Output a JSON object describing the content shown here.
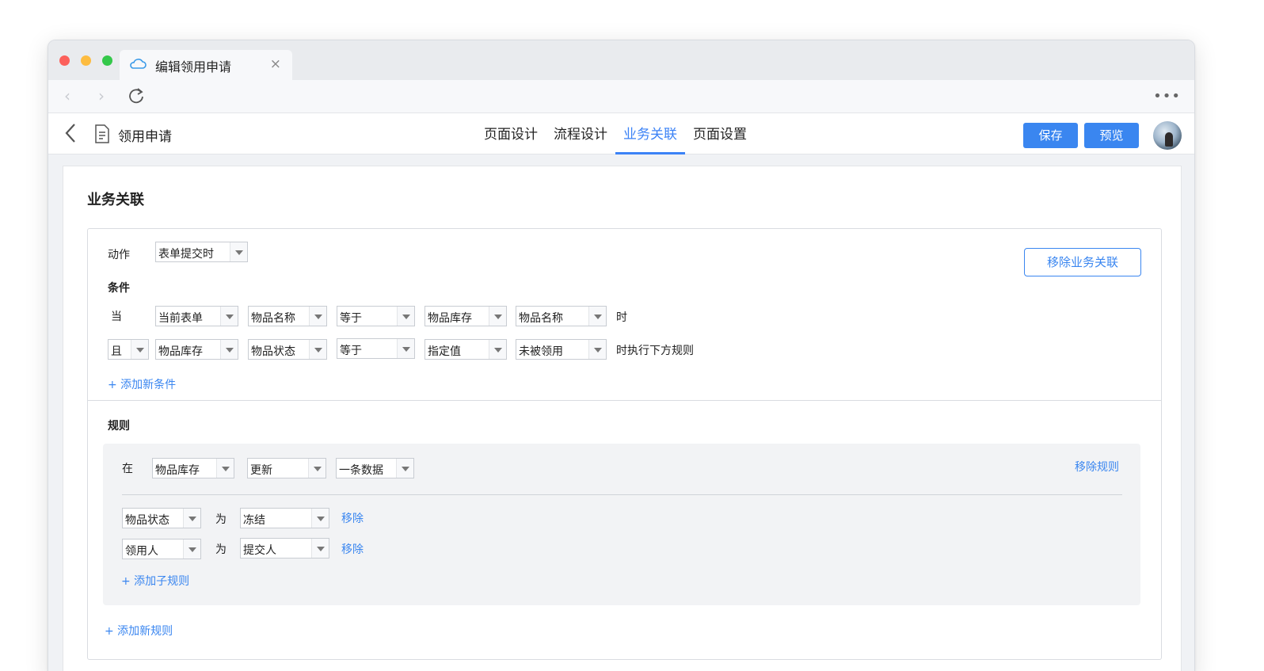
{
  "browser": {
    "tab_title": "编辑领用申请",
    "tab_close": "×",
    "back": "‹",
    "forward": "›",
    "more": "•••"
  },
  "app": {
    "title": "领用申请",
    "tabs": [
      "页面设计",
      "流程设计",
      "业务关联",
      "页面设置"
    ],
    "active_tab": "业务关联",
    "save_label": "保存",
    "preview_label": "预览",
    "accent_color": "#3a86f0"
  },
  "page": {
    "section_title": "业务关联",
    "remove_association": "移除业务关联",
    "action": {
      "label": "动作",
      "value": "表单提交时"
    },
    "conditions": {
      "label": "条件",
      "row1": {
        "prefix": "当",
        "fields": [
          "当前表单",
          "物品名称",
          "等于",
          "物品库存",
          "物品名称"
        ],
        "suffix": "时"
      },
      "row2": {
        "connector": "且",
        "fields": [
          "物品库存",
          "物品状态",
          "等于",
          "指定值",
          "未被领用"
        ],
        "suffix": "时执行下方规则"
      },
      "add_label": "+ 添加新条件"
    },
    "rules": {
      "label": "规则",
      "in_label": "在",
      "target": [
        "物品库存",
        "更新",
        "一条数据"
      ],
      "remove_rule": "移除规则",
      "sub_rules": [
        {
          "field": "物品状态",
          "as": "为",
          "value": "冻结",
          "remove": "移除"
        },
        {
          "field": "领用人",
          "as": "为",
          "value": "提交人",
          "remove": "移除"
        }
      ],
      "add_sub_rule": "+ 添加子规则",
      "add_rule": "+ 添加新规则"
    }
  }
}
